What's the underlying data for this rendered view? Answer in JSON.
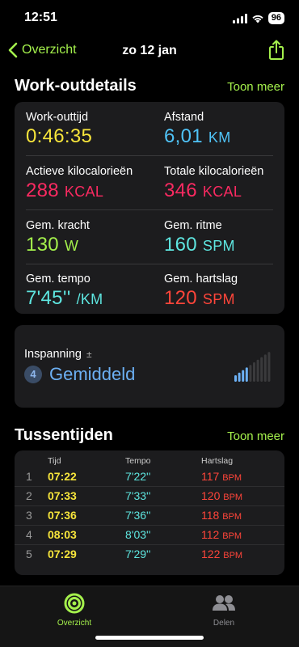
{
  "status": {
    "time": "12:51",
    "battery": "96"
  },
  "nav": {
    "back_label": "Overzicht",
    "title": "zo 12 jan"
  },
  "details": {
    "title": "Work-outdetails",
    "more": "Toon meer",
    "metrics": [
      {
        "label": "Work-outtijd",
        "value": "0:46:35",
        "unit": "",
        "color": "#f7e53b"
      },
      {
        "label": "Afstand",
        "value": "6,01",
        "unit": "KM",
        "color": "#4fc3f7"
      },
      {
        "label": "Actieve kilocalorieën",
        "value": "288",
        "unit": "KCAL",
        "color": "#fa2a61"
      },
      {
        "label": "Totale kilocalorieën",
        "value": "346",
        "unit": "KCAL",
        "color": "#fa2a61"
      },
      {
        "label": "Gem. kracht",
        "value": "130",
        "unit": "W",
        "color": "#a4f04c"
      },
      {
        "label": "Gem. ritme",
        "value": "160",
        "unit": "SPM",
        "color": "#5ee6e0"
      },
      {
        "label": "Gem. tempo",
        "value": "7'45''",
        "unit": "/KM",
        "color": "#5ee6e0"
      },
      {
        "label": "Gem. hartslag",
        "value": "120",
        "unit": "SPM",
        "color": "#ff453a"
      }
    ]
  },
  "effort": {
    "label": "Inspanning",
    "symbol": "±",
    "level": "4",
    "text": "Gemiddeld",
    "level_fraction": 0.4
  },
  "splits": {
    "title": "Tussentijden",
    "more": "Toon meer",
    "headers": {
      "time": "Tijd",
      "pace": "Tempo",
      "hr": "Hartslag"
    },
    "hr_unit": "BPM",
    "rows": [
      {
        "num": "1",
        "time": "07:22",
        "pace": "7'22''",
        "hr": "117"
      },
      {
        "num": "2",
        "time": "07:33",
        "pace": "7'33''",
        "hr": "120"
      },
      {
        "num": "3",
        "time": "07:36",
        "pace": "7'36''",
        "hr": "118"
      },
      {
        "num": "4",
        "time": "08:03",
        "pace": "8'03''",
        "hr": "112"
      },
      {
        "num": "5",
        "time": "07:29",
        "pace": "7'29''",
        "hr": "122"
      }
    ]
  },
  "tabs": [
    {
      "label": "Overzicht",
      "active": true,
      "color": "#a4f04c"
    },
    {
      "label": "Delen",
      "active": false,
      "color": "#8e8e93"
    }
  ],
  "colors": {
    "accent": "#a4f04c",
    "card": "#1c1c1e"
  }
}
